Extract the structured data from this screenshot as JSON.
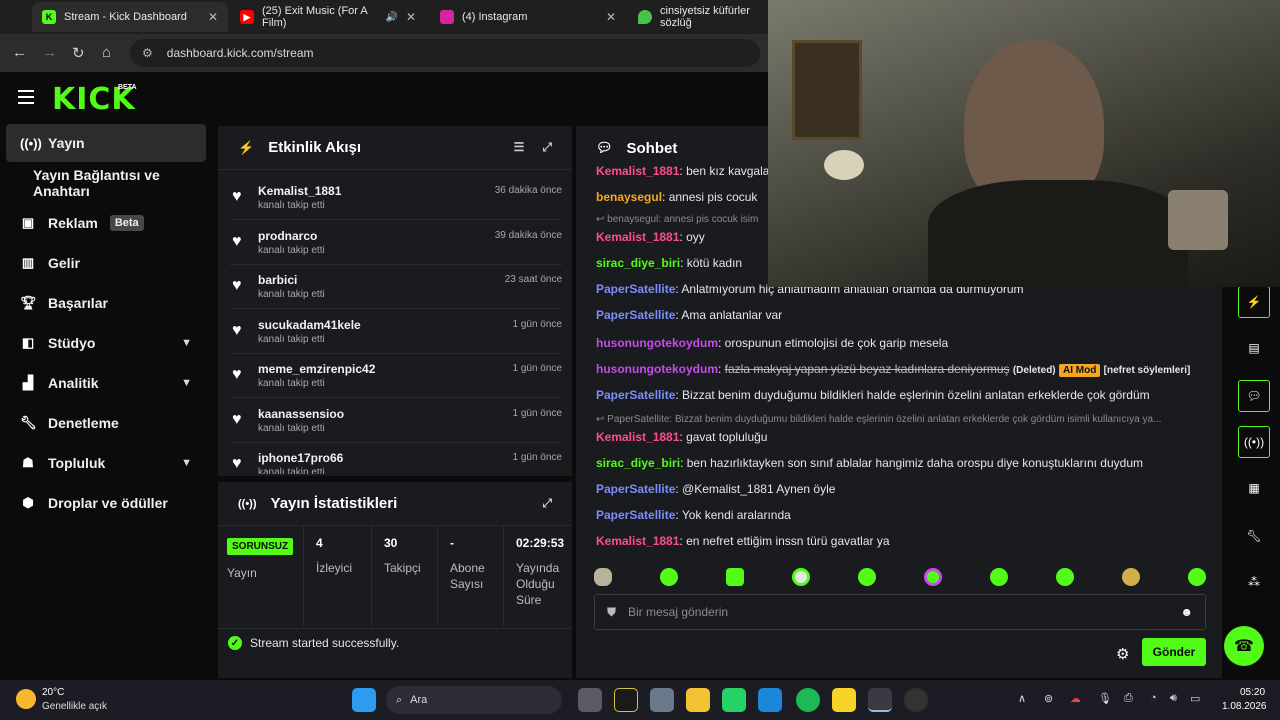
{
  "browser": {
    "tabs": [
      {
        "title": "Stream - Kick Dashboard",
        "favicon": "kick-icon",
        "color": "#53fc18"
      },
      {
        "title": "(25) Exit Music (For A Film)",
        "favicon": "youtube-icon",
        "color": "#ff0000"
      },
      {
        "title": "(4) Instagram",
        "favicon": "instagram-icon",
        "color": "#d6249f"
      },
      {
        "title": "cinsiyetsiz küfürler sözlüğ",
        "favicon": "leaf-icon",
        "color": "#46c34a"
      }
    ],
    "url": "dashboard.kick.com/stream"
  },
  "header": {
    "logo": "KICK",
    "logo_badge": "BETA"
  },
  "sidebar": {
    "items": [
      {
        "label": "Yayın",
        "icon": "broadcast-icon",
        "active": true
      },
      {
        "label": "Yayın Bağlantısı ve Anahtarı",
        "icon": ""
      },
      {
        "label": "Reklam",
        "icon": "ad-icon",
        "badge": "Beta"
      },
      {
        "label": "Gelir",
        "icon": "revenue-icon"
      },
      {
        "label": "Başarılar",
        "icon": "trophy-icon"
      },
      {
        "label": "Stüdyo",
        "icon": "studio-icon",
        "expandable": true
      },
      {
        "label": "Analitik",
        "icon": "analytics-icon",
        "expandable": true
      },
      {
        "label": "Denetleme",
        "icon": "wrench-icon"
      },
      {
        "label": "Topluluk",
        "icon": "community-icon",
        "expandable": true
      },
      {
        "label": "Droplar ve ödüller",
        "icon": "drops-icon"
      }
    ]
  },
  "activity": {
    "title": "Etkinlik Akışı",
    "events": [
      {
        "user": "Kemalist_1881",
        "action": "kanalı takip etti",
        "time": "36 dakika önce"
      },
      {
        "user": "prodnarco",
        "action": "kanalı takip etti",
        "time": "39 dakika önce"
      },
      {
        "user": "barbici",
        "action": "kanalı takip etti",
        "time": "23 saat önce"
      },
      {
        "user": "sucukadam41kele",
        "action": "kanalı takip etti",
        "time": "1 gün önce"
      },
      {
        "user": "meme_emzirenpic42",
        "action": "kanalı takip etti",
        "time": "1 gün önce"
      },
      {
        "user": "kaanassensioo",
        "action": "kanalı takip etti",
        "time": "1 gün önce"
      },
      {
        "user": "iphone17pro66",
        "action": "kanalı takip etti",
        "time": "1 gün önce"
      }
    ]
  },
  "stats": {
    "title": "Yayın İstatistikleri",
    "status_badge": "SORUNSUZ",
    "status_label": "Yayın",
    "viewers": "4",
    "viewers_label": "İzleyici",
    "followers": "30",
    "followers_label": "Takipçi",
    "subs": "-",
    "subs_label": "Abone Sayısı",
    "uptime": "02:29:53",
    "uptime_label": "Yayında Olduğu Süre",
    "toast": "Stream started successfully."
  },
  "chat": {
    "title": "Sohbet",
    "messages": [
      {
        "user": "Kemalist_1881",
        "color": "#ff4f8b",
        "text": "ben kız kavgaları"
      },
      {
        "user": "benaysegul",
        "color": "#f5a623",
        "text": "annesi pis cocuk"
      },
      {
        "reply": "benaysegul: annesi pis cocuk isim"
      },
      {
        "user": "Kemalist_1881",
        "color": "#ff4f8b",
        "text": "oyy"
      },
      {
        "user": "sirac_diye_biri",
        "color": "#53fc18",
        "text": "kötü kadın"
      },
      {
        "user": "PaperSatellite",
        "color": "#7b8cff",
        "text": "Anlatmıyorum hiç anlatmadım anlatılan ortamda da durmuyorum"
      },
      {
        "user": "PaperSatellite",
        "color": "#7b8cff",
        "text": "Ama anlatanlar var"
      },
      {
        "user": "husonungotekoydum",
        "color": "#c24ee6",
        "text": "orospunun etimolojisi de çok garip mesela"
      },
      {
        "user": "husonungotekoydum",
        "color": "#c24ee6",
        "text": "fazla makyaj yapan yüzü beyaz kadınlara deniyormuş",
        "deleted": "(Deleted)",
        "mod": "AI Mod",
        "reason": "[nefret söylemleri]"
      },
      {
        "user": "PaperSatellite",
        "color": "#7b8cff",
        "text": "Bizzat benim duyduğumu bildikleri halde eşlerinin özelini anlatan erkeklerde çok gördüm"
      },
      {
        "reply": "PaperSatellite: Bizzat benim duyduğumu bildikleri halde eşlerinin özelini anlatan erkeklerde çok gördüm isimli kullanıcıya ya..."
      },
      {
        "user": "Kemalist_1881",
        "color": "#ff4f8b",
        "text": "gavat topluluğu"
      },
      {
        "user": "sirac_diye_biri",
        "color": "#53fc18",
        "text": "ben hazırlıktayken son sınıf ablalar hangimiz daha orospu diye konuştuklarını duydum"
      },
      {
        "user": "PaperSatellite",
        "color": "#7b8cff",
        "text": "@Kemalist_1881 Aynen öyle"
      },
      {
        "user": "PaperSatellite",
        "color": "#7b8cff",
        "text": "Yok kendi aralarında"
      },
      {
        "user": "Kemalist_1881",
        "color": "#ff4f8b",
        "text": "en nefret ettiğim inssn türü gavatlar ya"
      }
    ],
    "input_placeholder": "Bir mesaj gönderin",
    "send_label": "Gönder"
  },
  "taskbar": {
    "weather_temp": "20°C",
    "weather_desc": "Genellikle açık",
    "search_label": "Ara",
    "time": "05:20",
    "date": "1.08.2026"
  }
}
